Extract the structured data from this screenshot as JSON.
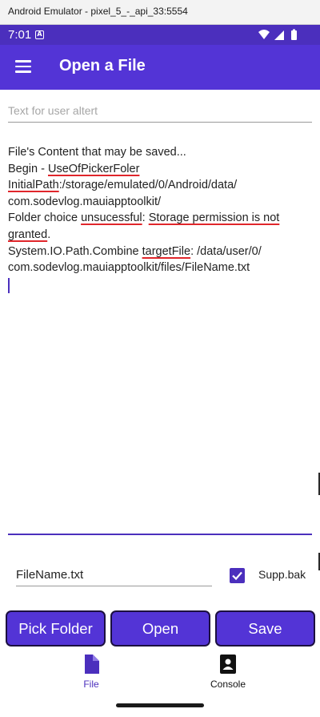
{
  "emulator": {
    "title": "Android Emulator - pixel_5_-_api_33:5554"
  },
  "status_bar": {
    "time": "7:01",
    "notif_badge": "A"
  },
  "app_bar": {
    "title": "Open a File",
    "menu_icon": "hamburger-icon"
  },
  "alert_input": {
    "placeholder": "Text for user altert",
    "value": ""
  },
  "content": {
    "lines": [
      [
        {
          "t": "File's Content that may be saved..."
        }
      ],
      [
        {
          "t": "Begin - "
        },
        {
          "t": "UseOfPickerFoler",
          "sq": true
        }
      ],
      [
        {
          "t": "InitialPath",
          "sq": true
        },
        {
          "t": ":/storage/emulated/0/Android/data/"
        }
      ],
      [
        {
          "t": "com.sodevlog.mauiapptoolkit/"
        }
      ],
      [
        {
          "t": "Folder choice "
        },
        {
          "t": "unsucessful",
          "sq": true
        },
        {
          "t": ": "
        },
        {
          "t": "Storage permission is not",
          "sq": true
        }
      ],
      [
        {
          "t": "granted",
          "sq": true
        },
        {
          "t": "."
        }
      ],
      [
        {
          "t": "System.IO.Path.Combine "
        },
        {
          "t": "targetFile",
          "sq": true
        },
        {
          "t": ": /data/user/0/"
        }
      ],
      [
        {
          "t": "com.sodevlog.mauiapptoolkit/files/FileName.txt"
        }
      ]
    ]
  },
  "filename_input": {
    "value": "FileName.txt"
  },
  "backup_checkbox": {
    "label": "Supp.bak",
    "checked": true
  },
  "buttons": {
    "pick_folder": "Pick Folder",
    "open": "Open",
    "save": "Save"
  },
  "tabs": [
    {
      "label": "File",
      "icon": "file-icon",
      "active": true
    },
    {
      "label": "Console",
      "icon": "contact-card-icon",
      "active": false
    }
  ],
  "colors": {
    "primary": "#5334d6",
    "status_bar": "#4b2fbd",
    "squiggle": "#e0262b"
  }
}
